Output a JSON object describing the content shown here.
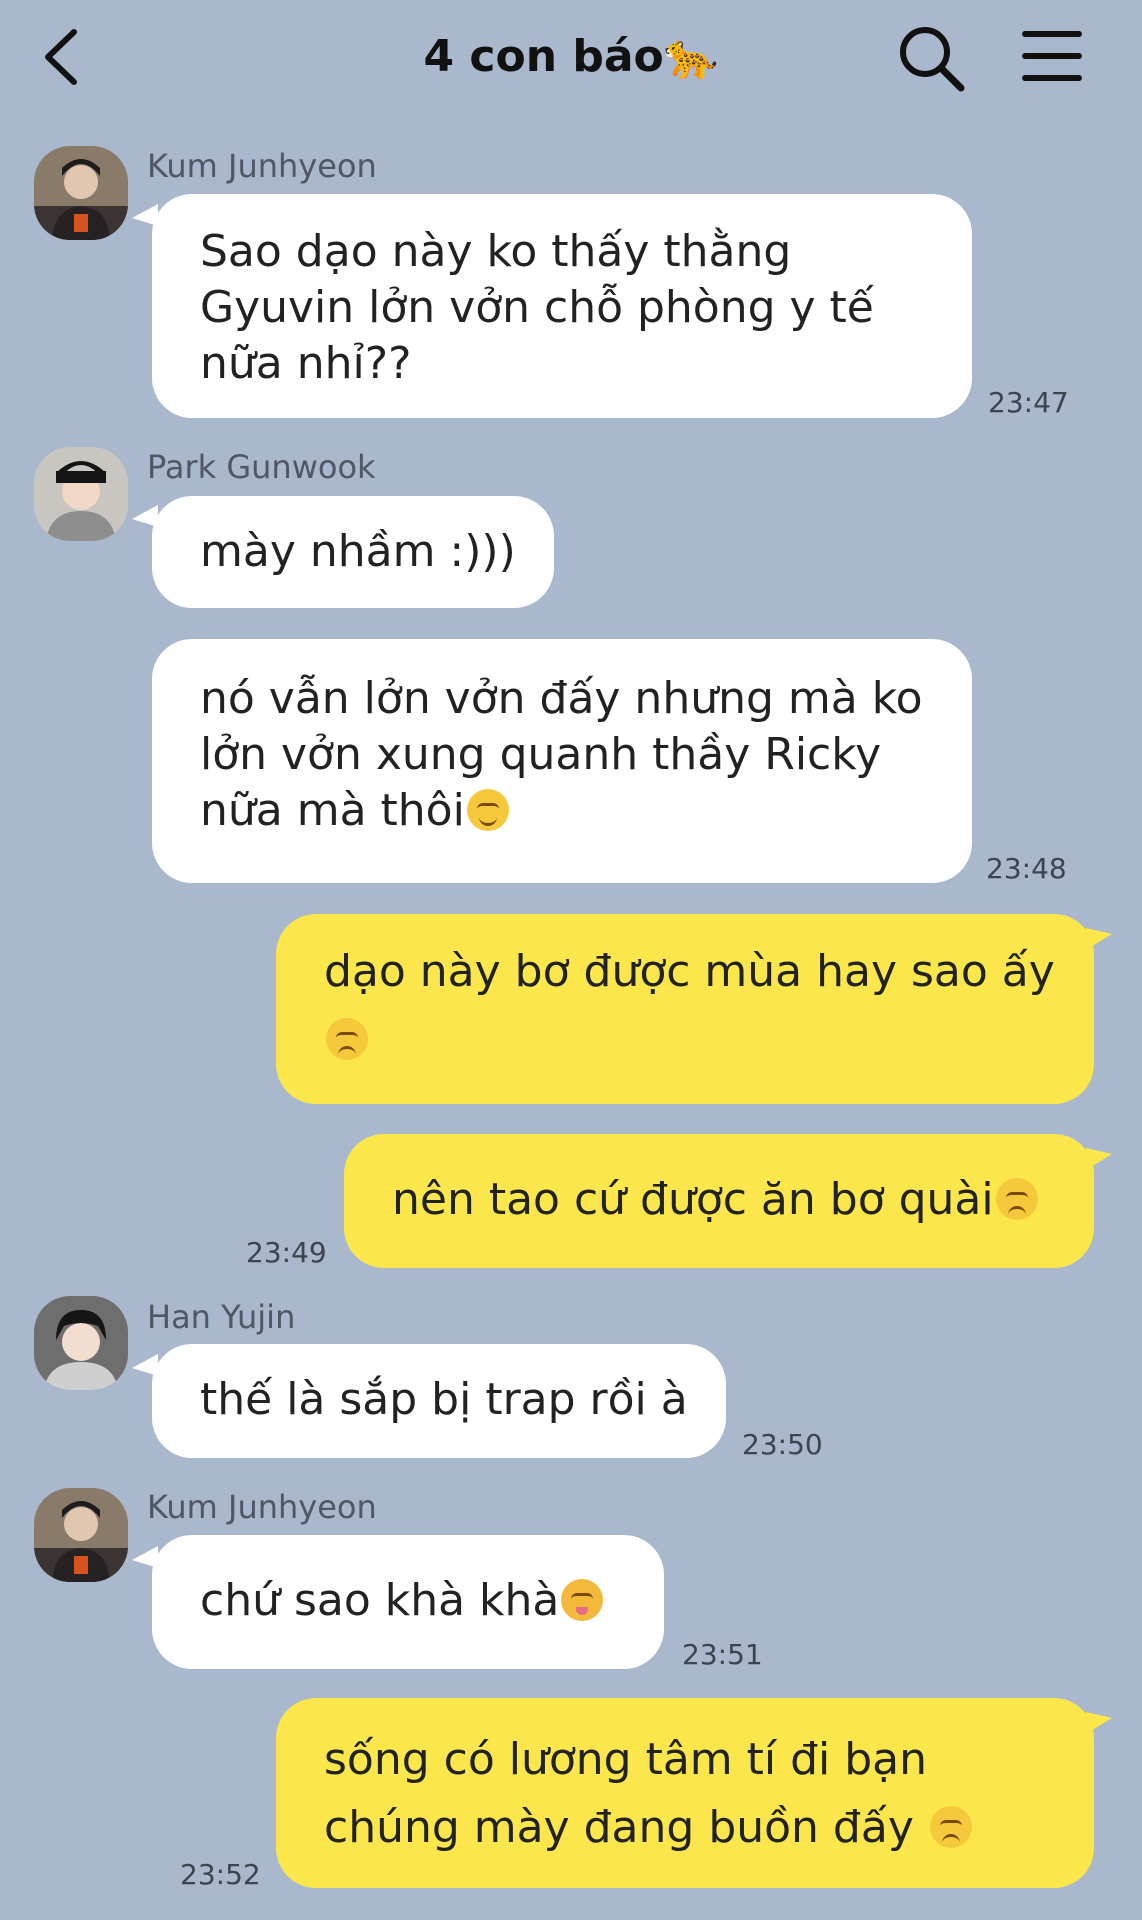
{
  "header": {
    "title": "4 con báo🐆",
    "back_icon": "chevron-left-icon",
    "search_icon": "search-icon",
    "menu_icon": "hamburger-menu-icon"
  },
  "messages": [
    {
      "sender": "Kum Junhyeon",
      "lines": [
        "Sao dạo này ko thấy thằng",
        "Gyuvin lởn vởn chỗ phòng y tế",
        "nữa nhỉ??"
      ],
      "time": "23:47"
    },
    {
      "sender": "Park Gunwook",
      "lines": [
        "mày nhầm :)))"
      ]
    },
    {
      "lines": [
        "nó vẫn lởn vởn đấy nhưng mà ko",
        "lởn vởn xung quanh thầy Ricky",
        "nữa mà thôi"
      ],
      "emoji": "relieved-face-emoji",
      "time": "23:48"
    },
    {
      "lines": [
        "dạo này bơ được mùa hay sao ấy"
      ],
      "emoji": "disappointed-face-emoji"
    },
    {
      "lines": [
        "nên tao cứ được ăn bơ quài"
      ],
      "emoji": "disappointed-face-emoji",
      "time": "23:49"
    },
    {
      "sender": "Han Yujin",
      "lines": [
        "thế là sắp bị trap rồi à"
      ],
      "time": "23:50"
    },
    {
      "sender": "Kum Junhyeon",
      "lines": [
        "chứ sao khà khà"
      ],
      "emoji": "zany-face-emoji",
      "time": "23:51"
    },
    {
      "lines": [
        "sống có lương tâm tí đi bạn",
        "chúng mày đang buồn đấy"
      ],
      "emoji": "disappointed-face-emoji",
      "time": "23:52"
    }
  ],
  "colors": {
    "background": "#a9b8cc",
    "incoming_bubble": "#ffffff",
    "outgoing_bubble": "#fbe74b"
  }
}
